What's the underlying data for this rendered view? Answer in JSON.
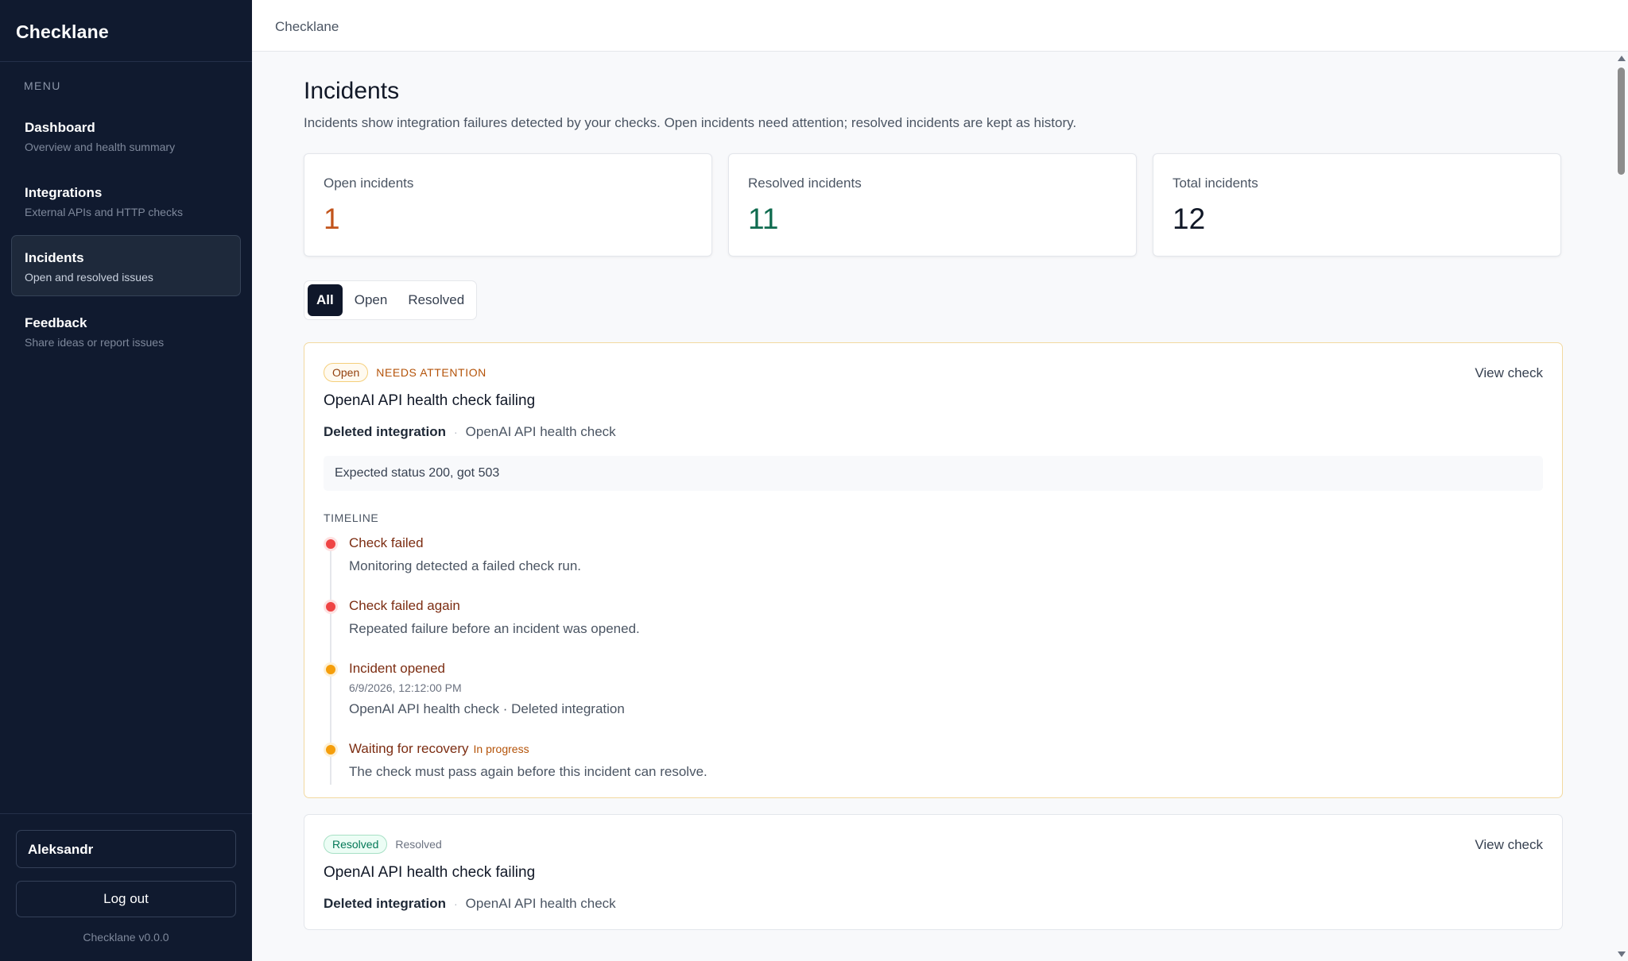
{
  "app": {
    "name": "Checklane",
    "version": "Checklane v0.0.0"
  },
  "topbar": {
    "breadcrumb": "Checklane"
  },
  "sidebar": {
    "menu_label": "MENU",
    "items": [
      {
        "title": "Dashboard",
        "subtitle": "Overview and health summary"
      },
      {
        "title": "Integrations",
        "subtitle": "External APIs and HTTP checks"
      },
      {
        "title": "Incidents",
        "subtitle": "Open and resolved issues"
      },
      {
        "title": "Feedback",
        "subtitle": "Share ideas or report issues"
      }
    ],
    "active_index": 2,
    "user_name": "Aleksandr",
    "logout_label": "Log out"
  },
  "page": {
    "title": "Incidents",
    "description": "Incidents show integration failures detected by your checks. Open incidents need attention; resolved incidents are kept as history."
  },
  "stats": [
    {
      "label": "Open incidents",
      "value": "1",
      "color": "#c2541b"
    },
    {
      "label": "Resolved incidents",
      "value": "11",
      "color": "#0f6b4f"
    },
    {
      "label": "Total incidents",
      "value": "12",
      "color": "#111827"
    }
  ],
  "filters": {
    "options": [
      "All",
      "Open",
      "Resolved"
    ],
    "selected": "All"
  },
  "incidents": [
    {
      "status": "Open",
      "status_note": "NEEDS ATTENTION",
      "view_label": "View check",
      "title": "OpenAI API health check failing",
      "integration": "Deleted integration",
      "check_name": "OpenAI API health check",
      "error": "Expected status 200, got 503",
      "timeline_label": "TIMELINE",
      "timeline": [
        {
          "title": "Check failed",
          "desc": "Monitoring detected a failed check run.",
          "dot": "red"
        },
        {
          "title": "Check failed again",
          "desc": "Repeated failure before an incident was opened.",
          "dot": "red"
        },
        {
          "title": "Incident opened",
          "timestamp": "6/9/2026, 12:12:00 PM",
          "desc": "OpenAI API health check · Deleted integration",
          "dot": "amber"
        },
        {
          "title": "Waiting for recovery",
          "tag": "In progress",
          "desc": "The check must pass again before this incident can resolve.",
          "dot": "amber"
        }
      ]
    },
    {
      "status": "Resolved",
      "status_note": "Resolved",
      "view_label": "View check",
      "title": "OpenAI API health check failing",
      "integration": "Deleted integration",
      "check_name": "OpenAI API health check"
    }
  ]
}
